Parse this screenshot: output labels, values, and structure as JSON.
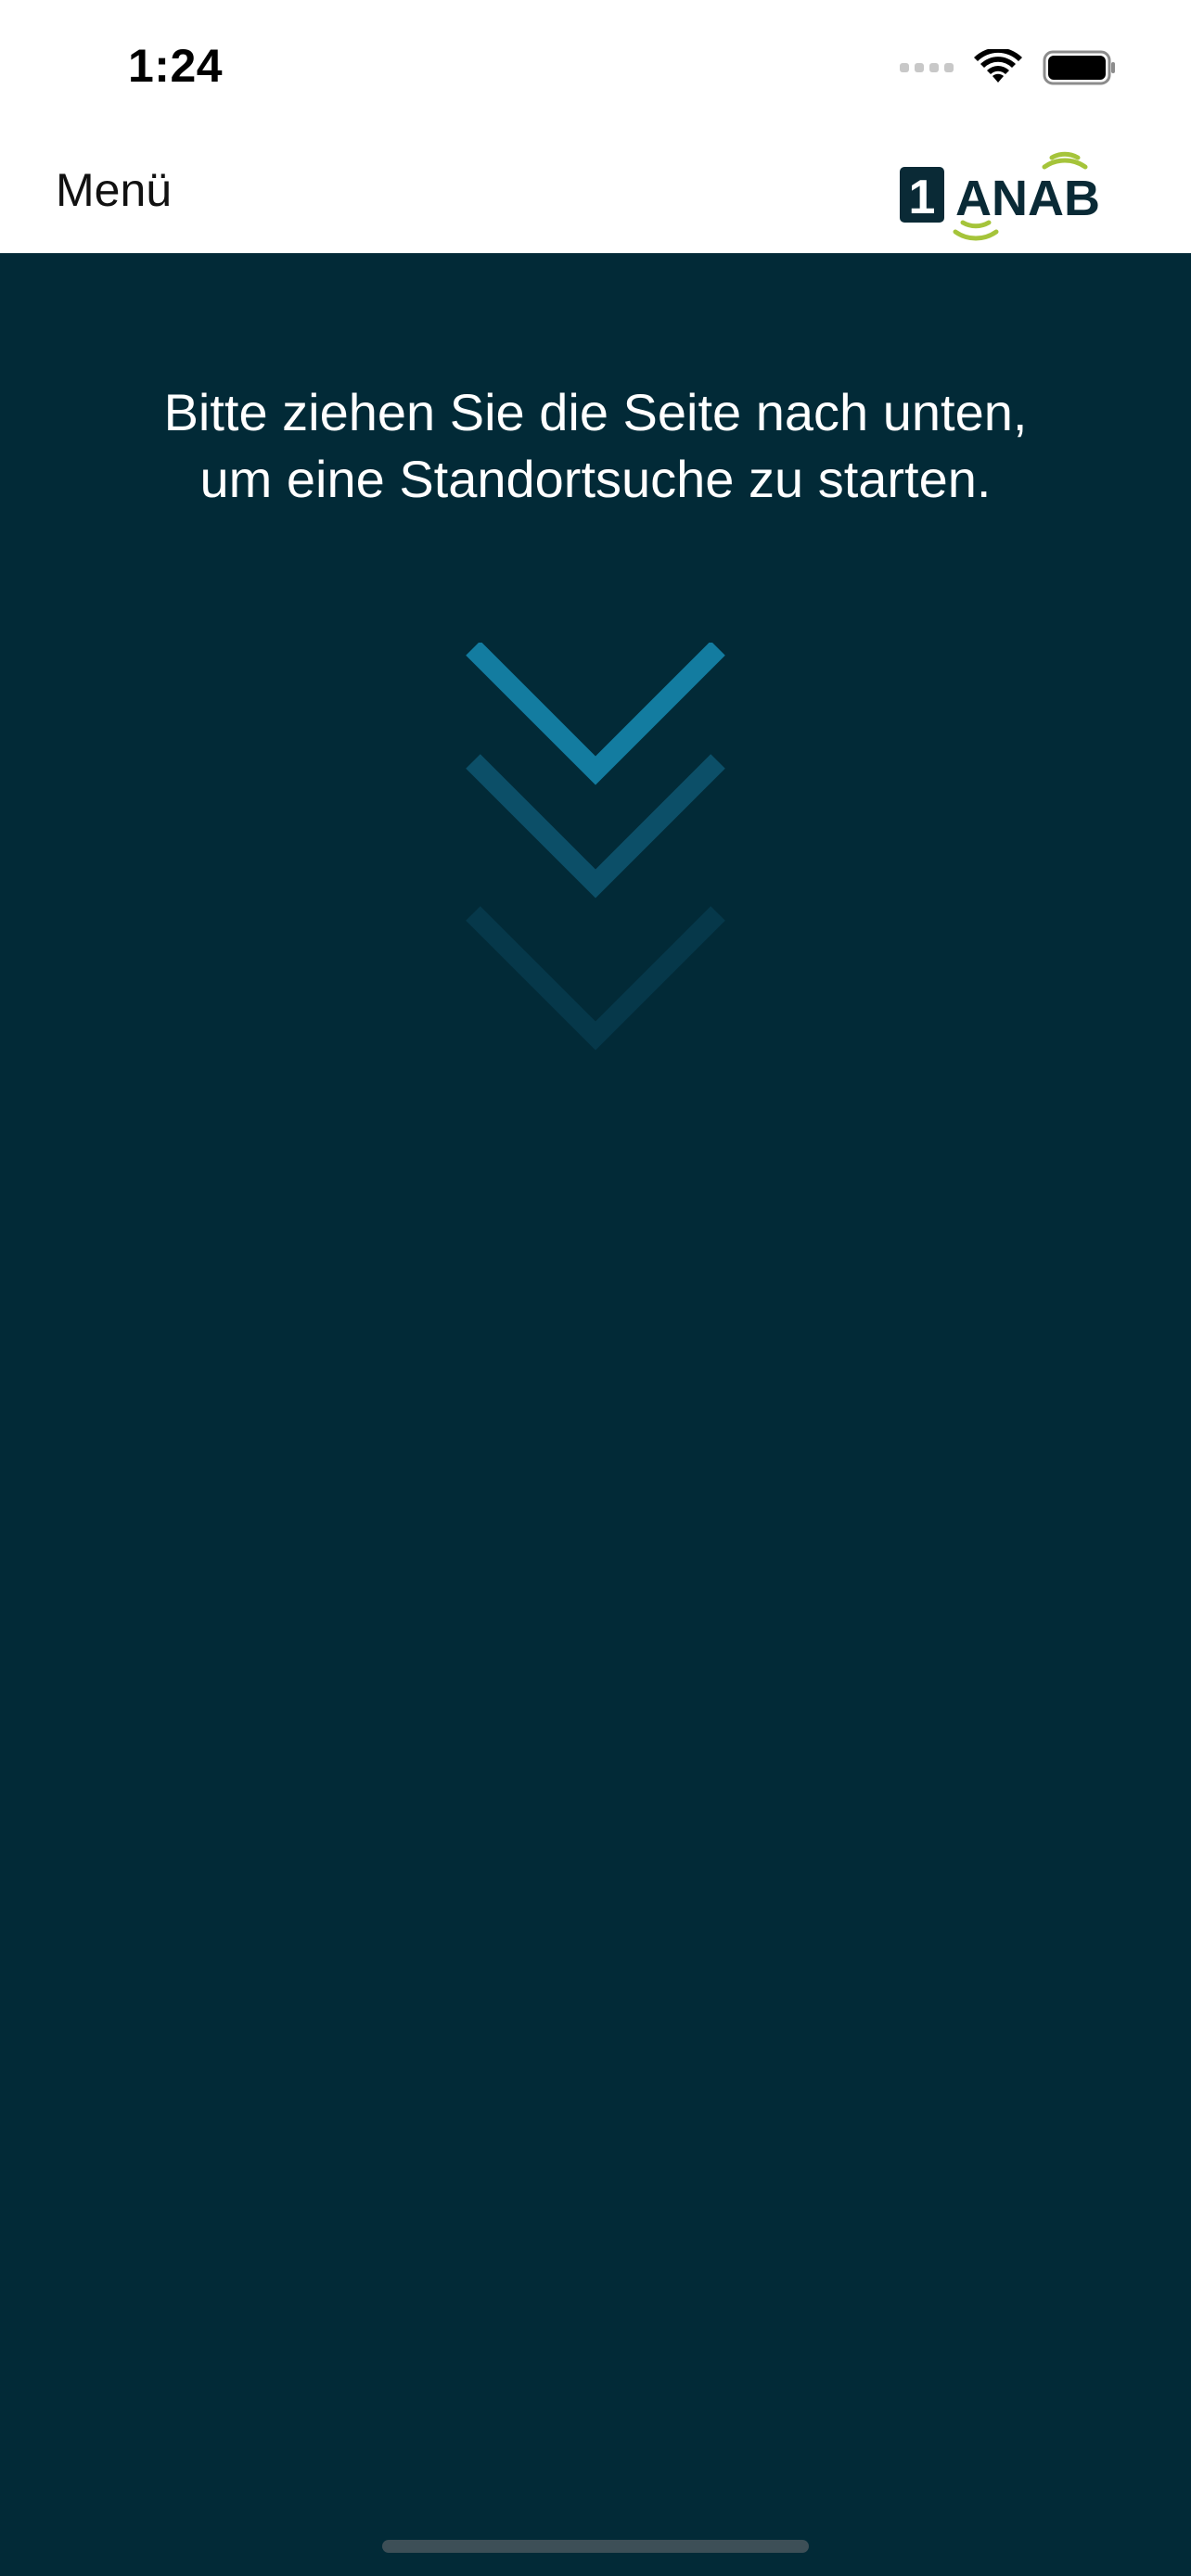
{
  "status_bar": {
    "time": "1:24",
    "icons": [
      "signal-icon",
      "wifi-icon",
      "battery-icon"
    ]
  },
  "nav": {
    "menu_label": "Menü",
    "logo_icon": "anab-logo-icon",
    "logo_text": "ANAB",
    "logo_number": "1"
  },
  "main": {
    "instruction_line1": "Bitte ziehen Sie die Seite nach unten,",
    "instruction_line2": "um eine Standortsuche zu starten.",
    "chevron_icon": "chevron-down-icon"
  },
  "colors": {
    "background": "#022a37",
    "header": "#ffffff",
    "chevron_1": "#137ca0",
    "chevron_2": "#0c4f68",
    "chevron_3": "#06384a",
    "logo_dark": "#0a2a36",
    "logo_green": "#a5c43a"
  }
}
